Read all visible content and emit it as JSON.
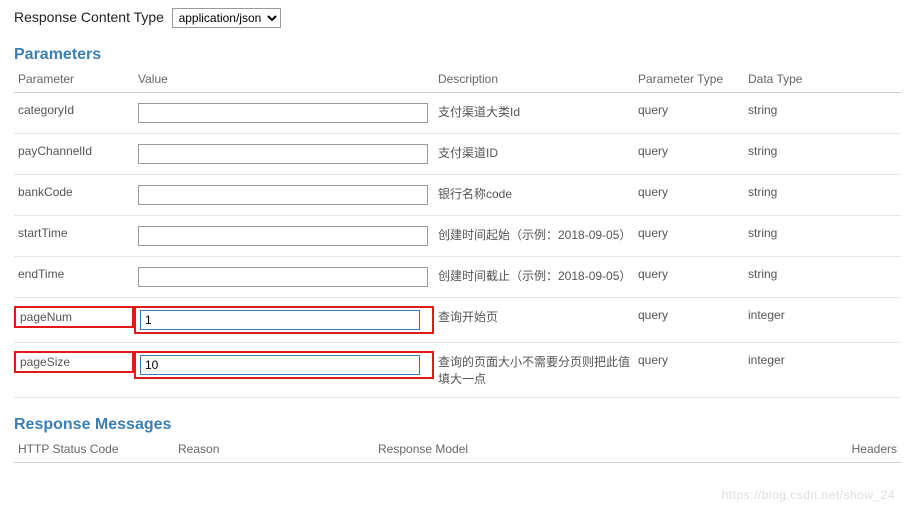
{
  "contentType": {
    "label": "Response Content Type",
    "selected": "application/json"
  },
  "parameters": {
    "heading": "Parameters",
    "columns": {
      "param": "Parameter",
      "value": "Value",
      "desc": "Description",
      "ptype": "Parameter Type",
      "dtype": "Data Type"
    },
    "rows": [
      {
        "name": "categoryId",
        "value": "",
        "desc": "支付渠道大类Id",
        "ptype": "query",
        "dtype": "string",
        "highlighted": false
      },
      {
        "name": "payChannelId",
        "value": "",
        "desc": "支付渠道ID",
        "ptype": "query",
        "dtype": "string",
        "highlighted": false
      },
      {
        "name": "bankCode",
        "value": "",
        "desc": "银行名称code",
        "ptype": "query",
        "dtype": "string",
        "highlighted": false
      },
      {
        "name": "startTime",
        "value": "",
        "desc": "创建时间起始（示例：2018-09-05）",
        "ptype": "query",
        "dtype": "string",
        "highlighted": false
      },
      {
        "name": "endTime",
        "value": "",
        "desc": "创建时间截止（示例：2018-09-05）",
        "ptype": "query",
        "dtype": "string",
        "highlighted": false
      },
      {
        "name": "pageNum",
        "value": "1",
        "desc": "查询开始页",
        "ptype": "query",
        "dtype": "integer",
        "highlighted": true
      },
      {
        "name": "pageSize",
        "value": "10",
        "desc": "查询的页面大小不需要分页则把此值填大一点",
        "ptype": "query",
        "dtype": "integer",
        "highlighted": true
      }
    ]
  },
  "responseMessages": {
    "heading": "Response Messages",
    "columns": {
      "status": "HTTP Status Code",
      "reason": "Reason",
      "model": "Response Model",
      "headers": "Headers"
    }
  },
  "watermark": "https://blog.csdn.net/show_24"
}
